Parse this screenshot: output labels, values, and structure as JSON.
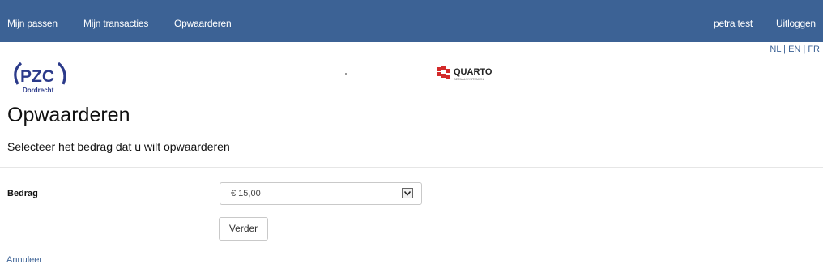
{
  "nav": {
    "left": [
      "Mijn passen",
      "Mijn transacties",
      "Opwaarderen"
    ],
    "user": "petra test",
    "logout": "Uitloggen",
    "background": "#3c6295"
  },
  "languages": {
    "nl": "NL",
    "en": "EN",
    "fr": "FR",
    "separator": " | "
  },
  "logos": {
    "pzc": {
      "text": "PZC",
      "sub": "Dordrecht",
      "color": "#2b3a8a"
    },
    "quarto": {
      "text": "QUARTO",
      "sub": "BETAALSYSTEMEN",
      "color": "#d32a2a"
    }
  },
  "page": {
    "title": "Opwaarderen",
    "subtitle": "Selecteer het bedrag dat u wilt opwaarderen"
  },
  "form": {
    "amount_label": "Bedrag",
    "amount_value": "€ 15,00",
    "next_button": "Verder",
    "cancel_link": "Annuleer"
  }
}
